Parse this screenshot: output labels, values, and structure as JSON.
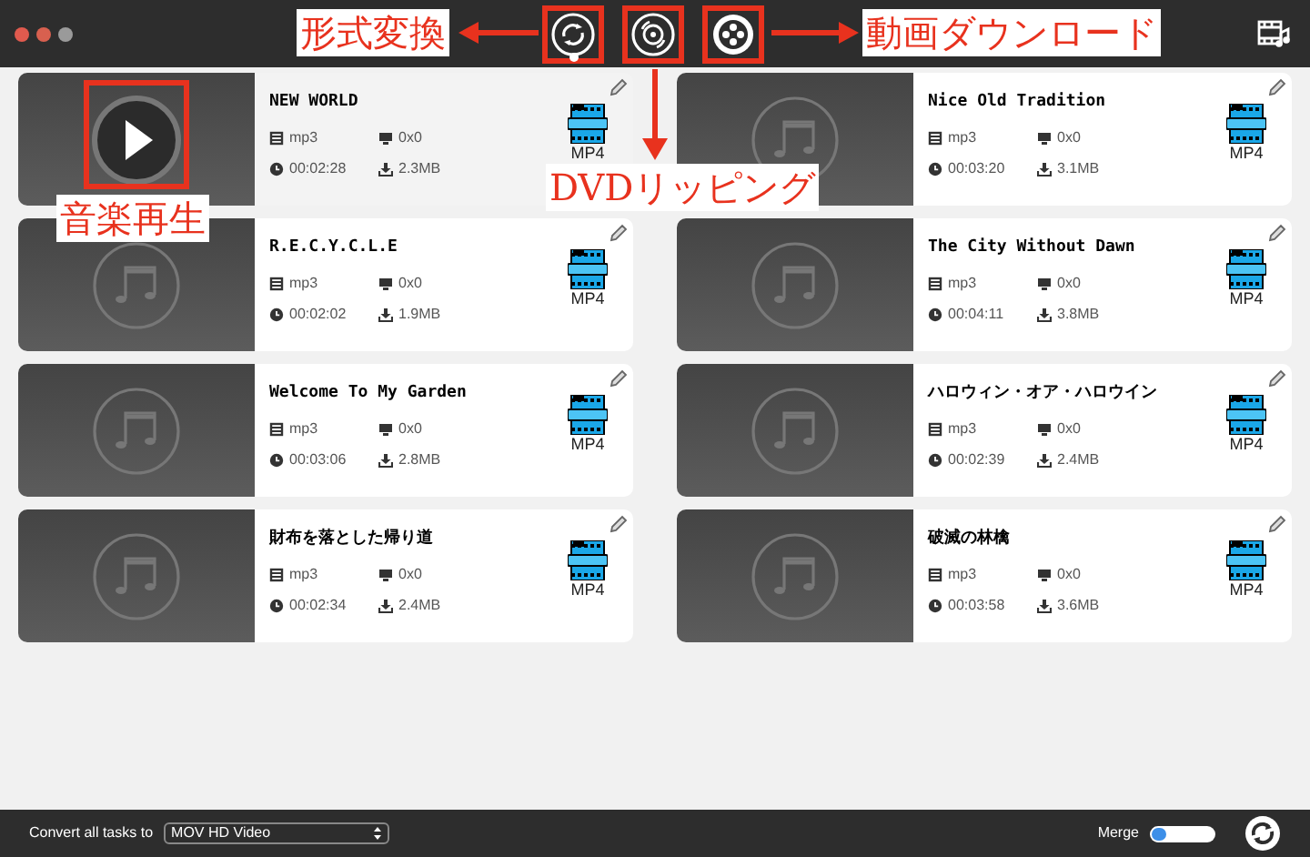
{
  "toolbar": {
    "modes": [
      {
        "kind": "convert",
        "selected": true,
        "boxed": true
      },
      {
        "kind": "dvd",
        "selected": false,
        "boxed": true
      },
      {
        "kind": "download",
        "selected": false,
        "boxed": true
      }
    ]
  },
  "tasks": [
    {
      "title": "NEW WORLD",
      "format": "mp3",
      "resolution": "0x0",
      "duration": "00:02:28",
      "size": "2.3MB",
      "output": "MP4",
      "selected": true,
      "boxed": true
    },
    {
      "title": "Nice Old Tradition",
      "format": "mp3",
      "resolution": "0x0",
      "duration": "00:03:20",
      "size": "3.1MB",
      "output": "MP4",
      "selected": false,
      "boxed": false
    },
    {
      "title": "R.E.C.Y.C.L.E",
      "format": "mp3",
      "resolution": "0x0",
      "duration": "00:02:02",
      "size": "1.9MB",
      "output": "MP4",
      "selected": false,
      "boxed": false
    },
    {
      "title": "The City Without Dawn",
      "format": "mp3",
      "resolution": "0x0",
      "duration": "00:04:11",
      "size": "3.8MB",
      "output": "MP4",
      "selected": false,
      "boxed": false
    },
    {
      "title": "Welcome To My Garden",
      "format": "mp3",
      "resolution": "0x0",
      "duration": "00:03:06",
      "size": "2.8MB",
      "output": "MP4",
      "selected": false,
      "boxed": false
    },
    {
      "title": "ハロウィン・オア・ハロウイン",
      "format": "mp3",
      "resolution": "0x0",
      "duration": "00:02:39",
      "size": "2.4MB",
      "output": "MP4",
      "selected": false,
      "boxed": false
    },
    {
      "title": "財布を落とした帰り道",
      "format": "mp3",
      "resolution": "0x0",
      "duration": "00:02:34",
      "size": "2.4MB",
      "output": "MP4",
      "selected": false,
      "boxed": false
    },
    {
      "title": "破滅の林檎",
      "format": "mp3",
      "resolution": "0x0",
      "duration": "00:03:58",
      "size": "3.6MB",
      "output": "MP4",
      "selected": false,
      "boxed": false
    }
  ],
  "footer": {
    "convert_label": "Convert all tasks to",
    "format_select": "MOV HD Video",
    "merge_label": "Merge",
    "merge_on": false
  },
  "annotations": [
    {
      "text": "形式変換",
      "kind": "left"
    },
    {
      "text": "DVDリッピング",
      "kind": "down"
    },
    {
      "text": "動画ダウンロード",
      "kind": "right"
    },
    {
      "text": "音楽再生",
      "kind": "plain"
    }
  ]
}
